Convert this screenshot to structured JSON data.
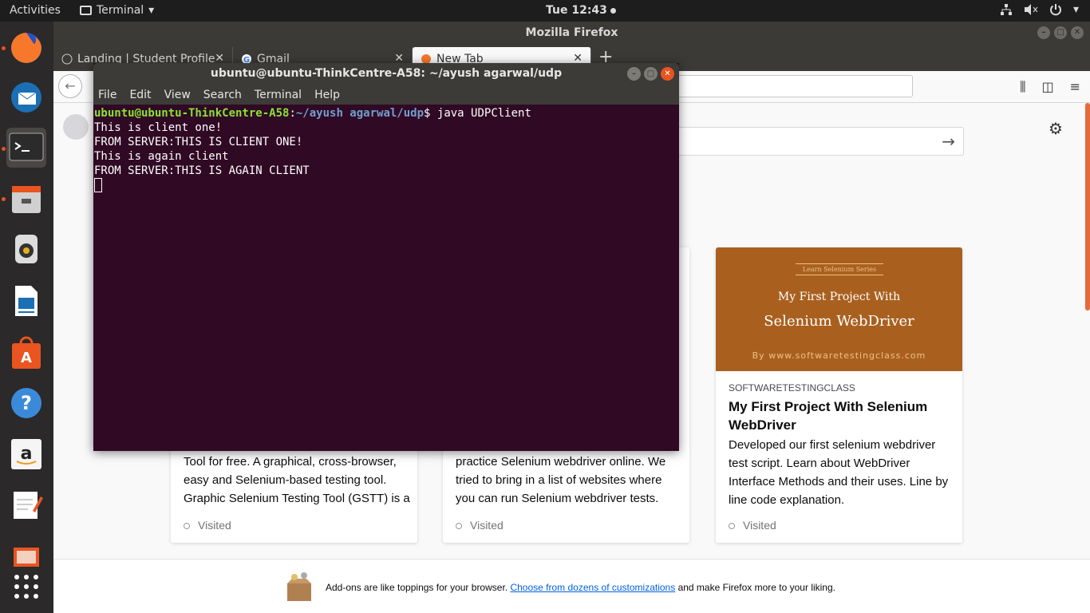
{
  "topbar": {
    "activities": "Activities",
    "app_menu": "Terminal",
    "clock": "Tue 12:43"
  },
  "firefox": {
    "window_title": "Mozilla Firefox",
    "tabs": [
      {
        "label": "Landing | Student Profile"
      },
      {
        "label": "Gmail"
      },
      {
        "label": "New Tab"
      }
    ],
    "cards": [
      {
        "desc": "Tool for free. A graphical, cross-browser, easy and Selenium-based testing tool. Graphic Selenium Testing Tool (GSTT) is a",
        "visited": "Visited"
      },
      {
        "desc": "practice Selenium webdriver online. We tried to bring in a list of websites where you can run Selenium webdriver tests.",
        "visited": "Visited"
      },
      {
        "thumb_small": "Learn Selenium Series",
        "thumb_line1": "My First Project With",
        "thumb_line2": "Selenium WebDriver",
        "thumb_line3": "By www.softwaretestingclass.com",
        "source": "SOFTWARETESTINGCLASS",
        "title": "My First Project With Selenium WebDriver",
        "desc": "Developed our first selenium webdriver test script. Learn about WebDriver Interface Methods and their uses. Line by line code explanation.",
        "visited": "Visited"
      }
    ],
    "footer": {
      "text_before": "Add-ons are like toppings for your browser.",
      "link": "Choose from dozens of customizations",
      "text_after": "and make Firefox more to your liking."
    },
    "colors": {
      "accent": "#e66a3a",
      "link": "#0060df",
      "thumb_bg": "#a9601f"
    }
  },
  "terminal": {
    "title": "ubuntu@ubuntu-ThinkCentre-A58: ~/ayush agarwal/udp",
    "menu": [
      "File",
      "Edit",
      "View",
      "Search",
      "Terminal",
      "Help"
    ],
    "prompt_user": "ubuntu@ubuntu-ThinkCentre-A58",
    "prompt_sep": ":",
    "prompt_path": "~/ayush agarwal/udp",
    "prompt_end": "$ java UDPClient",
    "lines": [
      "This is client one!",
      "FROM SERVER:THIS IS CLIENT ONE!",
      "This is again client",
      "FROM SERVER:THIS IS AGAIN CLIENT"
    ],
    "colors": {
      "background": "#300a24",
      "user": "#8ae234",
      "path": "#729fcf"
    }
  },
  "dock": {
    "items": [
      "firefox-icon",
      "thunderbird-icon",
      "terminal-icon",
      "files-icon",
      "rhythmbox-icon",
      "libreoffice-writer-icon",
      "software-center-icon",
      "help-icon",
      "amazon-icon",
      "text-editor-icon",
      "document-viewer-icon",
      "show-apps-icon"
    ]
  }
}
